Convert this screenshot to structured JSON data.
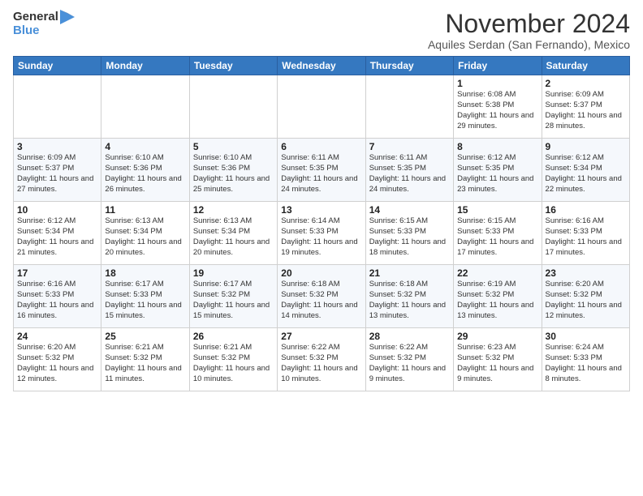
{
  "header": {
    "logo_line1": "General",
    "logo_line2": "Blue",
    "month": "November 2024",
    "location": "Aquiles Serdan (San Fernando), Mexico"
  },
  "weekdays": [
    "Sunday",
    "Monday",
    "Tuesday",
    "Wednesday",
    "Thursday",
    "Friday",
    "Saturday"
  ],
  "weeks": [
    [
      {
        "day": "",
        "info": ""
      },
      {
        "day": "",
        "info": ""
      },
      {
        "day": "",
        "info": ""
      },
      {
        "day": "",
        "info": ""
      },
      {
        "day": "",
        "info": ""
      },
      {
        "day": "1",
        "info": "Sunrise: 6:08 AM\nSunset: 5:38 PM\nDaylight: 11 hours\nand 29 minutes."
      },
      {
        "day": "2",
        "info": "Sunrise: 6:09 AM\nSunset: 5:37 PM\nDaylight: 11 hours\nand 28 minutes."
      }
    ],
    [
      {
        "day": "3",
        "info": "Sunrise: 6:09 AM\nSunset: 5:37 PM\nDaylight: 11 hours\nand 27 minutes."
      },
      {
        "day": "4",
        "info": "Sunrise: 6:10 AM\nSunset: 5:36 PM\nDaylight: 11 hours\nand 26 minutes."
      },
      {
        "day": "5",
        "info": "Sunrise: 6:10 AM\nSunset: 5:36 PM\nDaylight: 11 hours\nand 25 minutes."
      },
      {
        "day": "6",
        "info": "Sunrise: 6:11 AM\nSunset: 5:35 PM\nDaylight: 11 hours\nand 24 minutes."
      },
      {
        "day": "7",
        "info": "Sunrise: 6:11 AM\nSunset: 5:35 PM\nDaylight: 11 hours\nand 24 minutes."
      },
      {
        "day": "8",
        "info": "Sunrise: 6:12 AM\nSunset: 5:35 PM\nDaylight: 11 hours\nand 23 minutes."
      },
      {
        "day": "9",
        "info": "Sunrise: 6:12 AM\nSunset: 5:34 PM\nDaylight: 11 hours\nand 22 minutes."
      }
    ],
    [
      {
        "day": "10",
        "info": "Sunrise: 6:12 AM\nSunset: 5:34 PM\nDaylight: 11 hours\nand 21 minutes."
      },
      {
        "day": "11",
        "info": "Sunrise: 6:13 AM\nSunset: 5:34 PM\nDaylight: 11 hours\nand 20 minutes."
      },
      {
        "day": "12",
        "info": "Sunrise: 6:13 AM\nSunset: 5:34 PM\nDaylight: 11 hours\nand 20 minutes."
      },
      {
        "day": "13",
        "info": "Sunrise: 6:14 AM\nSunset: 5:33 PM\nDaylight: 11 hours\nand 19 minutes."
      },
      {
        "day": "14",
        "info": "Sunrise: 6:15 AM\nSunset: 5:33 PM\nDaylight: 11 hours\nand 18 minutes."
      },
      {
        "day": "15",
        "info": "Sunrise: 6:15 AM\nSunset: 5:33 PM\nDaylight: 11 hours\nand 17 minutes."
      },
      {
        "day": "16",
        "info": "Sunrise: 6:16 AM\nSunset: 5:33 PM\nDaylight: 11 hours\nand 17 minutes."
      }
    ],
    [
      {
        "day": "17",
        "info": "Sunrise: 6:16 AM\nSunset: 5:33 PM\nDaylight: 11 hours\nand 16 minutes."
      },
      {
        "day": "18",
        "info": "Sunrise: 6:17 AM\nSunset: 5:33 PM\nDaylight: 11 hours\nand 15 minutes."
      },
      {
        "day": "19",
        "info": "Sunrise: 6:17 AM\nSunset: 5:32 PM\nDaylight: 11 hours\nand 15 minutes."
      },
      {
        "day": "20",
        "info": "Sunrise: 6:18 AM\nSunset: 5:32 PM\nDaylight: 11 hours\nand 14 minutes."
      },
      {
        "day": "21",
        "info": "Sunrise: 6:18 AM\nSunset: 5:32 PM\nDaylight: 11 hours\nand 13 minutes."
      },
      {
        "day": "22",
        "info": "Sunrise: 6:19 AM\nSunset: 5:32 PM\nDaylight: 11 hours\nand 13 minutes."
      },
      {
        "day": "23",
        "info": "Sunrise: 6:20 AM\nSunset: 5:32 PM\nDaylight: 11 hours\nand 12 minutes."
      }
    ],
    [
      {
        "day": "24",
        "info": "Sunrise: 6:20 AM\nSunset: 5:32 PM\nDaylight: 11 hours\nand 12 minutes."
      },
      {
        "day": "25",
        "info": "Sunrise: 6:21 AM\nSunset: 5:32 PM\nDaylight: 11 hours\nand 11 minutes."
      },
      {
        "day": "26",
        "info": "Sunrise: 6:21 AM\nSunset: 5:32 PM\nDaylight: 11 hours\nand 10 minutes."
      },
      {
        "day": "27",
        "info": "Sunrise: 6:22 AM\nSunset: 5:32 PM\nDaylight: 11 hours\nand 10 minutes."
      },
      {
        "day": "28",
        "info": "Sunrise: 6:22 AM\nSunset: 5:32 PM\nDaylight: 11 hours\nand 9 minutes."
      },
      {
        "day": "29",
        "info": "Sunrise: 6:23 AM\nSunset: 5:32 PM\nDaylight: 11 hours\nand 9 minutes."
      },
      {
        "day": "30",
        "info": "Sunrise: 6:24 AM\nSunset: 5:33 PM\nDaylight: 11 hours\nand 8 minutes."
      }
    ]
  ]
}
